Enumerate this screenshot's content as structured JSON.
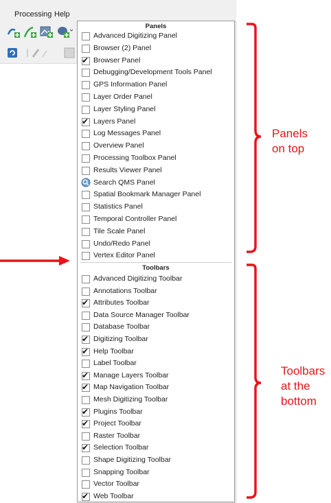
{
  "menubar": {
    "items": [
      "Processing",
      "Help"
    ]
  },
  "panels": {
    "header": "Panels",
    "items": [
      {
        "label": "Advanced Digitizing Panel",
        "checked": false
      },
      {
        "label": "Browser (2) Panel",
        "checked": false
      },
      {
        "label": "Browser Panel",
        "checked": true
      },
      {
        "label": "Debugging/Development Tools Panel",
        "checked": false
      },
      {
        "label": "GPS Information Panel",
        "checked": false
      },
      {
        "label": "Layer Order Panel",
        "checked": false
      },
      {
        "label": "Layer Styling Panel",
        "checked": false
      },
      {
        "label": "Layers Panel",
        "checked": true
      },
      {
        "label": "Log Messages Panel",
        "checked": false
      },
      {
        "label": "Overview Panel",
        "checked": false
      },
      {
        "label": "Processing Toolbox Panel",
        "checked": false
      },
      {
        "label": "Results Viewer Panel",
        "checked": false
      },
      {
        "label": "Search QMS Panel",
        "checked": false,
        "icon": "qms-search-icon"
      },
      {
        "label": "Spatial Bookmark Manager Panel",
        "checked": false
      },
      {
        "label": "Statistics Panel",
        "checked": false
      },
      {
        "label": "Temporal Controller Panel",
        "checked": false
      },
      {
        "label": "Tile Scale Panel",
        "checked": false
      },
      {
        "label": "Undo/Redo Panel",
        "checked": false
      },
      {
        "label": "Vertex Editor Panel",
        "checked": false
      }
    ]
  },
  "toolbars": {
    "header": "Toolbars",
    "items": [
      {
        "label": "Advanced Digitizing Toolbar",
        "checked": false
      },
      {
        "label": "Annotations Toolbar",
        "checked": false
      },
      {
        "label": "Attributes Toolbar",
        "checked": true
      },
      {
        "label": "Data Source Manager Toolbar",
        "checked": false
      },
      {
        "label": "Database Toolbar",
        "checked": false
      },
      {
        "label": "Digitizing Toolbar",
        "checked": true
      },
      {
        "label": "Help Toolbar",
        "checked": true
      },
      {
        "label": "Label Toolbar",
        "checked": false
      },
      {
        "label": "Manage Layers Toolbar",
        "checked": true
      },
      {
        "label": "Map Navigation Toolbar",
        "checked": true
      },
      {
        "label": "Mesh Digitizing Toolbar",
        "checked": false
      },
      {
        "label": "Plugins Toolbar",
        "checked": true
      },
      {
        "label": "Project Toolbar",
        "checked": true
      },
      {
        "label": "Raster Toolbar",
        "checked": false
      },
      {
        "label": "Selection Toolbar",
        "checked": true
      },
      {
        "label": "Shape Digitizing Toolbar",
        "checked": false
      },
      {
        "label": "Snapping Toolbar",
        "checked": false
      },
      {
        "label": "Vector Toolbar",
        "checked": false
      },
      {
        "label": "Web Toolbar",
        "checked": true
      }
    ]
  },
  "annotations": {
    "panels_note": [
      "Panels",
      "on top"
    ],
    "toolbars_note": [
      "Toolbars",
      "at the",
      "bottom"
    ]
  },
  "colors": {
    "annotation": "#e8141a",
    "checkmark": "#111111"
  }
}
